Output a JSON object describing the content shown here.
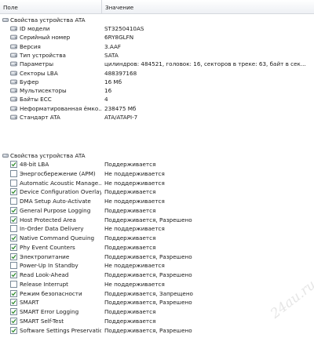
{
  "header": {
    "col_field": "Поле",
    "col_value": "Значение"
  },
  "section1": {
    "title": "Свойства устройства ATA",
    "rows": [
      {
        "label": "ID модели",
        "value": "ST3250410AS"
      },
      {
        "label": "Серийный номер",
        "value": "6RY8GLFN"
      },
      {
        "label": "Версия",
        "value": "3.AAF"
      },
      {
        "label": "Тип устройства",
        "value": "SATA"
      },
      {
        "label": "Параметры",
        "value": "цилиндров: 484521, головок: 16, секторов в треке: 63, байт в сек..."
      },
      {
        "label": "Секторы LBA",
        "value": "488397168"
      },
      {
        "label": "Буфер",
        "value": "16 Мб"
      },
      {
        "label": "Мультисекторы",
        "value": "16"
      },
      {
        "label": "Байты ECC",
        "value": "4"
      },
      {
        "label": "Неформатированная ёмко...",
        "value": "238475 Мб"
      },
      {
        "label": "Стандарт ATA",
        "value": "ATA/ATAPI-7"
      }
    ]
  },
  "section2": {
    "title": "Свойства устройства ATA",
    "rows": [
      {
        "label": "48-bit LBA",
        "value": "Поддерживается",
        "checked": true
      },
      {
        "label": "Энергосбережение (APM)",
        "value": "Не поддерживается",
        "checked": false
      },
      {
        "label": "Automatic Acoustic Manage...",
        "value": "Не поддерживается",
        "checked": false
      },
      {
        "label": "Device Configuration Overlay",
        "value": "Поддерживается",
        "checked": true
      },
      {
        "label": "DMA Setup Auto-Activate",
        "value": "Не поддерживается",
        "checked": false
      },
      {
        "label": "General Purpose Logging",
        "value": "Поддерживается",
        "checked": true
      },
      {
        "label": "Host Protected Area",
        "value": "Поддерживается, Разрешено",
        "checked": true
      },
      {
        "label": "In-Order Data Delivery",
        "value": "Не поддерживается",
        "checked": false
      },
      {
        "label": "Native Command Queuing",
        "value": "Поддерживается",
        "checked": true
      },
      {
        "label": "Phy Event Counters",
        "value": "Поддерживается",
        "checked": true
      },
      {
        "label": "Электропитание",
        "value": "Поддерживается, Разрешено",
        "checked": true
      },
      {
        "label": "Power-Up In Standby",
        "value": "Не поддерживается",
        "checked": false
      },
      {
        "label": "Read Look-Ahead",
        "value": "Поддерживается, Разрешено",
        "checked": true
      },
      {
        "label": "Release Interrupt",
        "value": "Не поддерживается",
        "checked": false
      },
      {
        "label": "Режим безопасности",
        "value": "Поддерживается, Запрещено",
        "checked": true
      },
      {
        "label": "SMART",
        "value": "Поддерживается, Разрешено",
        "checked": true
      },
      {
        "label": "SMART Error Logging",
        "value": "Поддерживается",
        "checked": true
      },
      {
        "label": "SMART Self-Test",
        "value": "Поддерживается",
        "checked": true
      },
      {
        "label": "Software Settings Preservation",
        "value": "Поддерживается, Разрешено",
        "checked": true
      }
    ]
  },
  "watermark": "24au.ru",
  "colors": {
    "check": "#2e8b2e",
    "header_border": "#d5d8de",
    "checkbox_border": "#7a8a99"
  }
}
